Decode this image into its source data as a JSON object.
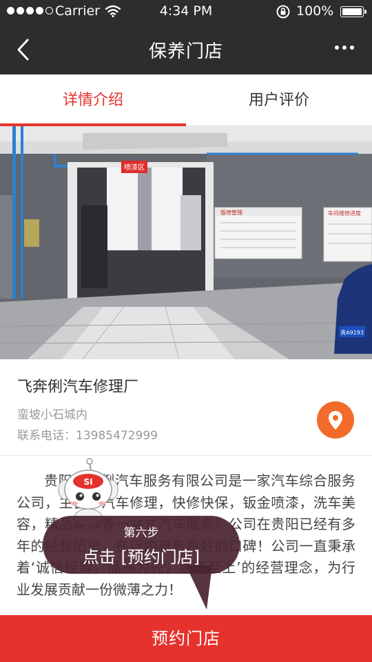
{
  "status_bar": {
    "carrier": "Carrier",
    "time": "4:34 PM",
    "battery": "100%"
  },
  "nav": {
    "title": "保养门店"
  },
  "tabs": [
    {
      "label": "详情介绍",
      "active": true
    },
    {
      "label": "用户评价",
      "active": false
    }
  ],
  "photo": {
    "sign_left": "喷漆区",
    "board_1": "钣喷管理",
    "board_2": "车间维修进度",
    "plate": "贵A9193"
  },
  "shop": {
    "name": "飞奔俐汽车修理厂",
    "address": "蛮坡小石城内",
    "phone": "联系电话：13985472999"
  },
  "description": "贵阳飞奔俐汽车服务有限公司是一家汽车综合服务公司，主营：汽车修理，快修快保，钣金喷漆，洗车美容，精品装饰等一站式汽车服务！公司在贵阳已经有多年的经营历史，在行内具有良好的口碑！公司一直秉承着‘诚信经营，品质为先，服务至上’的经营理念，为行业发展贡献一份微薄之力！",
  "book_button": "预约门店",
  "guide": {
    "step": "第六步",
    "action": "点击 [预约门店]",
    "mascot_badge": "SI"
  },
  "colors": {
    "accent": "#e5322d",
    "location": "#f26b2b",
    "header": "#2e2c2d",
    "bubble": "#4a2532"
  }
}
